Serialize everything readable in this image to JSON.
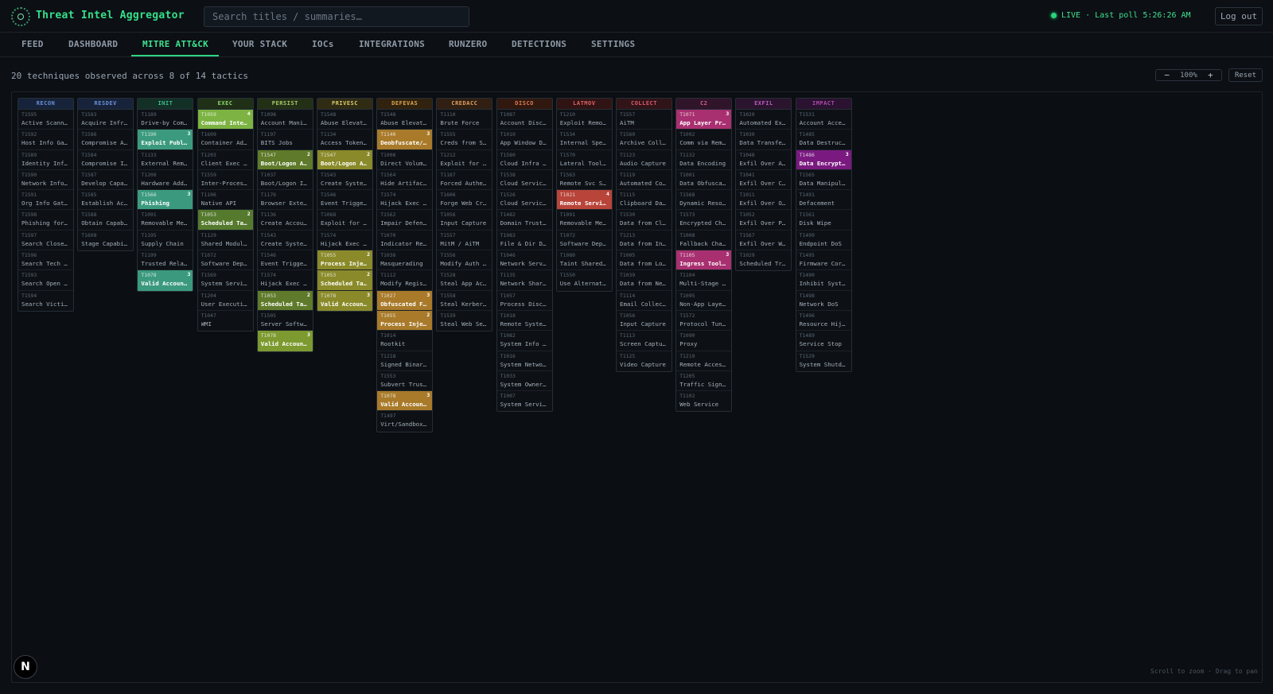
{
  "app": {
    "title": "Threat Intel Aggregator",
    "logo_icon": "radar-icon"
  },
  "search": {
    "placeholder": "Search titles / summaries…"
  },
  "status": {
    "live_label": "LIVE · Last poll 5:26:26 AM"
  },
  "header": {
    "logout_label": "Log out"
  },
  "tabs": [
    {
      "label": "FEED",
      "active": false
    },
    {
      "label": "DASHBOARD",
      "active": false
    },
    {
      "label": "MITRE ATT&CK",
      "active": true
    },
    {
      "label": "YOUR STACK",
      "active": false
    },
    {
      "label": "IOCs",
      "active": false
    },
    {
      "label": "INTEGRATIONS",
      "active": false
    },
    {
      "label": "RUNZERO",
      "active": false
    },
    {
      "label": "DETECTIONS",
      "active": false
    },
    {
      "label": "SETTINGS",
      "active": false
    }
  ],
  "matrix": {
    "summary": "20 techniques observed across 8 of 14 tactics",
    "zoom": {
      "minus": "−",
      "value": "100%",
      "plus": "+"
    },
    "reset_label": "Reset",
    "hint": "Scroll to zoom · Drag to pan",
    "tactics": [
      {
        "label": "RECON",
        "color": "#6a8fd8",
        "header_bg": "#16233a",
        "hit_color": "#3a6fb0",
        "techniques": [
          {
            "id": "T1595",
            "name": "Active Scanning"
          },
          {
            "id": "T1592",
            "name": "Host Info Gathering"
          },
          {
            "id": "T1589",
            "name": "Identity Info Gathering"
          },
          {
            "id": "T1590",
            "name": "Network Info Gathering"
          },
          {
            "id": "T1591",
            "name": "Org Info Gather"
          },
          {
            "id": "T1598",
            "name": "Phishing for Info"
          },
          {
            "id": "T1597",
            "name": "Search Closed Sources"
          },
          {
            "id": "T1596",
            "name": "Search Tech DBs"
          },
          {
            "id": "T1593",
            "name": "Search Open Web"
          },
          {
            "id": "T1594",
            "name": "Search Victim-Owned Sites"
          }
        ]
      },
      {
        "label": "RESDEV",
        "color": "#6a8fd8",
        "header_bg": "#16233a",
        "hit_color": "#3a6fb0",
        "techniques": [
          {
            "id": "T1583",
            "name": "Acquire Infrastructure"
          },
          {
            "id": "T1586",
            "name": "Compromise Accounts"
          },
          {
            "id": "T1584",
            "name": "Compromise Infrastructure"
          },
          {
            "id": "T1587",
            "name": "Develop Capabilities"
          },
          {
            "id": "T1585",
            "name": "Establish Accounts"
          },
          {
            "id": "T1588",
            "name": "Obtain Capabilities"
          },
          {
            "id": "T1608",
            "name": "Stage Capabilities"
          }
        ]
      },
      {
        "label": "INIT",
        "color": "#3dbd8d",
        "header_bg": "#123026",
        "hit_color": "#3b9a7d",
        "techniques": [
          {
            "id": "T1189",
            "name": "Drive-by Compromise"
          },
          {
            "id": "T1190",
            "name": "Exploit Public-Facing App",
            "count": "3"
          },
          {
            "id": "T1133",
            "name": "External Remote Services"
          },
          {
            "id": "T1200",
            "name": "Hardware Additions"
          },
          {
            "id": "T1566",
            "name": "Phishing",
            "count": "3"
          },
          {
            "id": "T1091",
            "name": "Removable Media"
          },
          {
            "id": "T1195",
            "name": "Supply Chain"
          },
          {
            "id": "T1199",
            "name": "Trusted Relationship"
          },
          {
            "id": "T1078",
            "name": "Valid Accounts",
            "count": "3"
          }
        ]
      },
      {
        "label": "EXEC",
        "color": "#8ed86a",
        "header_bg": "#1f3016",
        "hit_color": "#6a9f3c",
        "techniques": [
          {
            "id": "T1059",
            "name": "Command Interpreter",
            "count": "4",
            "hit_color": "#7cb342"
          },
          {
            "id": "T1609",
            "name": "Container Admin Command"
          },
          {
            "id": "T1203",
            "name": "Client Exec Exploit"
          },
          {
            "id": "T1559",
            "name": "Inter-Process Comm"
          },
          {
            "id": "T1106",
            "name": "Native API"
          },
          {
            "id": "T1053",
            "name": "Scheduled Task/Job",
            "count": "2",
            "hit_color": "#557a2e"
          },
          {
            "id": "T1129",
            "name": "Shared Modules"
          },
          {
            "id": "T1072",
            "name": "Software Deployment"
          },
          {
            "id": "T1569",
            "name": "System Services"
          },
          {
            "id": "T1204",
            "name": "User Execution"
          },
          {
            "id": "T1047",
            "name": "WMI"
          }
        ]
      },
      {
        "label": "PERSIST",
        "color": "#a8c86a",
        "header_bg": "#243016",
        "hit_color": "#6c8a30",
        "techniques": [
          {
            "id": "T1098",
            "name": "Account Manipulation"
          },
          {
            "id": "T1197",
            "name": "BITS Jobs"
          },
          {
            "id": "T1547",
            "name": "Boot/Logon Autostart",
            "count": "2",
            "hit_color": "#5e7a2a"
          },
          {
            "id": "T1037",
            "name": "Boot/Logon Init Scripts"
          },
          {
            "id": "T1176",
            "name": "Browser Extensions"
          },
          {
            "id": "T1136",
            "name": "Create Account"
          },
          {
            "id": "T1543",
            "name": "Create System Process"
          },
          {
            "id": "T1546",
            "name": "Event Triggered Exec"
          },
          {
            "id": "T1574",
            "name": "Hijack Exec Flow"
          },
          {
            "id": "T1053",
            "name": "Scheduled Task/Job",
            "count": "2",
            "hit_color": "#5e7a2a"
          },
          {
            "id": "T1505",
            "name": "Server Software Component"
          },
          {
            "id": "T1078",
            "name": "Valid Accounts",
            "count": "3",
            "hit_color": "#7c9a30"
          }
        ]
      },
      {
        "label": "PRIVESC",
        "color": "#d8c86a",
        "header_bg": "#302c14",
        "hit_color": "#8a8a2a",
        "techniques": [
          {
            "id": "T1548",
            "name": "Abuse Elevation Control"
          },
          {
            "id": "T1134",
            "name": "Access Token Manipulation"
          },
          {
            "id": "T1547",
            "name": "Boot/Logon Autostart",
            "count": "2"
          },
          {
            "id": "T1543",
            "name": "Create System Process"
          },
          {
            "id": "T1546",
            "name": "Event Triggered Exec"
          },
          {
            "id": "T1068",
            "name": "Exploit for Priv Esc"
          },
          {
            "id": "T1574",
            "name": "Hijack Exec Flow"
          },
          {
            "id": "T1055",
            "name": "Process Injection",
            "count": "2"
          },
          {
            "id": "T1053",
            "name": "Scheduled Task/Job",
            "count": "2"
          },
          {
            "id": "T1078",
            "name": "Valid Accounts",
            "count": "3"
          }
        ]
      },
      {
        "label": "DEFEVAS",
        "color": "#e0a850",
        "header_bg": "#30220f",
        "hit_color": "#a87a2a",
        "techniques": [
          {
            "id": "T1548",
            "name": "Abuse Elevation Control"
          },
          {
            "id": "T1140",
            "name": "Deobfuscate/Decode",
            "count": "3"
          },
          {
            "id": "T1006",
            "name": "Direct Volume Access"
          },
          {
            "id": "T1564",
            "name": "Hide Artifacts"
          },
          {
            "id": "T1574",
            "name": "Hijack Exec Flow"
          },
          {
            "id": "T1562",
            "name": "Impair Defenses"
          },
          {
            "id": "T1070",
            "name": "Indicator Removal"
          },
          {
            "id": "T1036",
            "name": "Masquerading"
          },
          {
            "id": "T1112",
            "name": "Modify Registry"
          },
          {
            "id": "T1027",
            "name": "Obfuscated Files",
            "count": "3"
          },
          {
            "id": "T1055",
            "name": "Process Injection",
            "count": "2"
          },
          {
            "id": "T1014",
            "name": "Rootkit"
          },
          {
            "id": "T1218",
            "name": "Signed Binary Proxy"
          },
          {
            "id": "T1553",
            "name": "Subvert Trust Controls"
          },
          {
            "id": "T1078",
            "name": "Valid Accounts",
            "count": "3"
          },
          {
            "id": "T1497",
            "name": "Virt/Sandbox Evasion"
          }
        ]
      },
      {
        "label": "CREDACC",
        "color": "#e0a060",
        "header_bg": "#301f12",
        "hit_color": "#a06a30",
        "techniques": [
          {
            "id": "T1110",
            "name": "Brute Force"
          },
          {
            "id": "T1555",
            "name": "Creds from Stores"
          },
          {
            "id": "T1212",
            "name": "Exploit for Cred Access"
          },
          {
            "id": "T1187",
            "name": "Forced Authentication"
          },
          {
            "id": "T1606",
            "name": "Forge Web Credentials"
          },
          {
            "id": "T1056",
            "name": "Input Capture"
          },
          {
            "id": "T1557",
            "name": "MitM / AiTM"
          },
          {
            "id": "T1556",
            "name": "Modify Auth Process"
          },
          {
            "id": "T1528",
            "name": "Steal App Access Token"
          },
          {
            "id": "T1558",
            "name": "Steal Kerberos Tickets"
          },
          {
            "id": "T1539",
            "name": "Steal Web Session Cookie"
          }
        ]
      },
      {
        "label": "DISCO",
        "color": "#e07a50",
        "header_bg": "#30180f",
        "hit_color": "#a04a2a",
        "techniques": [
          {
            "id": "T1087",
            "name": "Account Discovery"
          },
          {
            "id": "T1010",
            "name": "App Window Discovery"
          },
          {
            "id": "T1580",
            "name": "Cloud Infra Discovery"
          },
          {
            "id": "T1538",
            "name": "Cloud Service Dashboard"
          },
          {
            "id": "T1526",
            "name": "Cloud Service Discovery"
          },
          {
            "id": "T1482",
            "name": "Domain Trust Discovery"
          },
          {
            "id": "T1083",
            "name": "File & Dir Discovery"
          },
          {
            "id": "T1046",
            "name": "Network Service Discovery"
          },
          {
            "id": "T1135",
            "name": "Network Share Discovery"
          },
          {
            "id": "T1057",
            "name": "Process Discovery"
          },
          {
            "id": "T1018",
            "name": "Remote System Discovery"
          },
          {
            "id": "T1082",
            "name": "System Info Discovery"
          },
          {
            "id": "T1016",
            "name": "System Network Config"
          },
          {
            "id": "T1033",
            "name": "System Owner/User"
          },
          {
            "id": "T1007",
            "name": "System Service Discovery"
          }
        ]
      },
      {
        "label": "LATMOV",
        "color": "#e06060",
        "header_bg": "#301414",
        "hit_color": "#b8443a",
        "techniques": [
          {
            "id": "T1210",
            "name": "Exploit Remote Services"
          },
          {
            "id": "T1534",
            "name": "Internal Spearphishing"
          },
          {
            "id": "T1570",
            "name": "Lateral Tool Transfer"
          },
          {
            "id": "T1563",
            "name": "Remote Svc Session Hijack"
          },
          {
            "id": "T1021",
            "name": "Remote Services",
            "count": "4"
          },
          {
            "id": "T1091",
            "name": "Removable Media"
          },
          {
            "id": "T1072",
            "name": "Software Deployment"
          },
          {
            "id": "T1080",
            "name": "Taint Shared Content"
          },
          {
            "id": "T1550",
            "name": "Use Alternate Auth"
          }
        ]
      },
      {
        "label": "COLLECT",
        "color": "#e05a6a",
        "header_bg": "#301418",
        "hit_color": "#a8304a",
        "techniques": [
          {
            "id": "T1557",
            "name": "AiTM"
          },
          {
            "id": "T1560",
            "name": "Archive Collected Data"
          },
          {
            "id": "T1123",
            "name": "Audio Capture"
          },
          {
            "id": "T1119",
            "name": "Automated Collection"
          },
          {
            "id": "T1115",
            "name": "Clipboard Data"
          },
          {
            "id": "T1530",
            "name": "Data from Cloud Storage"
          },
          {
            "id": "T1213",
            "name": "Data from Info Repos"
          },
          {
            "id": "T1005",
            "name": "Data from Local System"
          },
          {
            "id": "T1039",
            "name": "Data from Network Share"
          },
          {
            "id": "T1114",
            "name": "Email Collection"
          },
          {
            "id": "T1056",
            "name": "Input Capture"
          },
          {
            "id": "T1113",
            "name": "Screen Capture"
          },
          {
            "id": "T1125",
            "name": "Video Capture"
          }
        ]
      },
      {
        "label": "C2",
        "color": "#e05a9a",
        "header_bg": "#30142a",
        "hit_color": "#a83070",
        "techniques": [
          {
            "id": "T1071",
            "name": "App Layer Protocol",
            "count": "3"
          },
          {
            "id": "T1092",
            "name": "Comm via Removable Media"
          },
          {
            "id": "T1132",
            "name": "Data Encoding"
          },
          {
            "id": "T1001",
            "name": "Data Obfuscation"
          },
          {
            "id": "T1568",
            "name": "Dynamic Resolution"
          },
          {
            "id": "T1573",
            "name": "Encrypted Channel"
          },
          {
            "id": "T1008",
            "name": "Fallback Channels"
          },
          {
            "id": "T1105",
            "name": "Ingress Tool Transfer",
            "count": "3"
          },
          {
            "id": "T1104",
            "name": "Multi-Stage Channels"
          },
          {
            "id": "T1095",
            "name": "Non-App Layer Protocol"
          },
          {
            "id": "T1572",
            "name": "Protocol Tunneling"
          },
          {
            "id": "T1090",
            "name": "Proxy"
          },
          {
            "id": "T1219",
            "name": "Remote Access Software"
          },
          {
            "id": "T1205",
            "name": "Traffic Signaling"
          },
          {
            "id": "T1102",
            "name": "Web Service"
          }
        ]
      },
      {
        "label": "EXFIL",
        "color": "#c05ac0",
        "header_bg": "#2a142e",
        "hit_color": "#8a3090",
        "techniques": [
          {
            "id": "T1020",
            "name": "Automated Exfiltration"
          },
          {
            "id": "T1030",
            "name": "Data Transfer Size Limits"
          },
          {
            "id": "T1048",
            "name": "Exfil Over Alt Protocol"
          },
          {
            "id": "T1041",
            "name": "Exfil Over C2 Channel"
          },
          {
            "id": "T1011",
            "name": "Exfil Over Other Network"
          },
          {
            "id": "T1052",
            "name": "Exfil Over Physical Medium"
          },
          {
            "id": "T1567",
            "name": "Exfil Over Web Service"
          },
          {
            "id": "T1029",
            "name": "Scheduled Transfer"
          }
        ]
      },
      {
        "label": "IMPACT",
        "color": "#b04ab0",
        "header_bg": "#2a1230",
        "hit_color": "#7a1a80",
        "techniques": [
          {
            "id": "T1531",
            "name": "Account Access Removal"
          },
          {
            "id": "T1485",
            "name": "Data Destruction"
          },
          {
            "id": "T1486",
            "name": "Data Encrypted for Impact",
            "count": "3"
          },
          {
            "id": "T1565",
            "name": "Data Manipulation"
          },
          {
            "id": "T1491",
            "name": "Defacement"
          },
          {
            "id": "T1561",
            "name": "Disk Wipe"
          },
          {
            "id": "T1499",
            "name": "Endpoint DoS"
          },
          {
            "id": "T1495",
            "name": "Firmware Corruption"
          },
          {
            "id": "T1490",
            "name": "Inhibit System Recovery"
          },
          {
            "id": "T1498",
            "name": "Network DoS"
          },
          {
            "id": "T1496",
            "name": "Resource Hijacking"
          },
          {
            "id": "T1489",
            "name": "Service Stop"
          },
          {
            "id": "T1529",
            "name": "System Shutdown/Reboot"
          }
        ]
      }
    ]
  },
  "fab": {
    "label": "N",
    "icon": "nextjs-icon"
  }
}
